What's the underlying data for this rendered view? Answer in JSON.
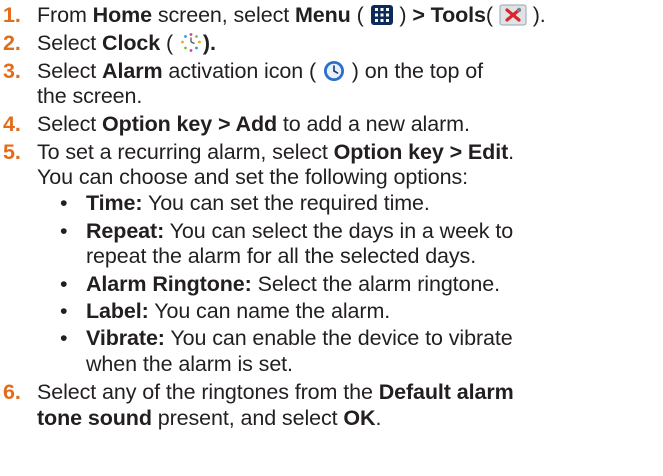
{
  "steps": [
    {
      "num": "1.",
      "t1": "From ",
      "b1": "Home",
      "t2": " screen, select ",
      "b2": "Menu",
      "t3": " ( ",
      "t4": " ) ",
      "b3": "> Tools",
      "t5": "( ",
      "t6": " )."
    },
    {
      "num": "2.",
      "t1": "Select ",
      "b1": "Clock",
      "t2": " ( ",
      "b2": ")."
    },
    {
      "num": "3.",
      "t1": "Select ",
      "b1": "Alarm",
      "t2": " activation icon ( ",
      "t3": " ) on the top of",
      "cont": "the screen."
    },
    {
      "num": "4.",
      "t1": "Select ",
      "b1": "Option key > Add",
      "t2": " to add a new alarm."
    },
    {
      "num": "5.",
      "t1": "To set a recurring alarm, select ",
      "b1": "Option key > Edit",
      "t2": ".",
      "cont": "You can choose and set the following options:"
    },
    {
      "num": "6.",
      "t1": "Select any of the ringtones from the ",
      "b1": "Default alarm",
      "cont_b": "tone sound",
      "cont_t1": " present, and select ",
      "cont_b2": "OK",
      "cont_t2": "."
    }
  ],
  "options": [
    {
      "label": "Time:",
      "text": " You can set the required time."
    },
    {
      "label": "Repeat:",
      "text": " You can select the days in a week to",
      "cont": "repeat the alarm for all the selected days."
    },
    {
      "label": "Alarm Ringtone:",
      "text": " Select the alarm ringtone."
    },
    {
      "label": "Label:",
      "text": " You can name the alarm."
    },
    {
      "label": "Vibrate:",
      "text": " You can enable the device to vibrate",
      "cont": "when the alarm is set."
    }
  ],
  "bullet_char": "•",
  "icons": [
    "menu-grid-icon",
    "tools-icon",
    "clock-icon",
    "alarm-icon"
  ],
  "colors": {
    "step_number": "#e36c1a",
    "text": "#231f20"
  }
}
